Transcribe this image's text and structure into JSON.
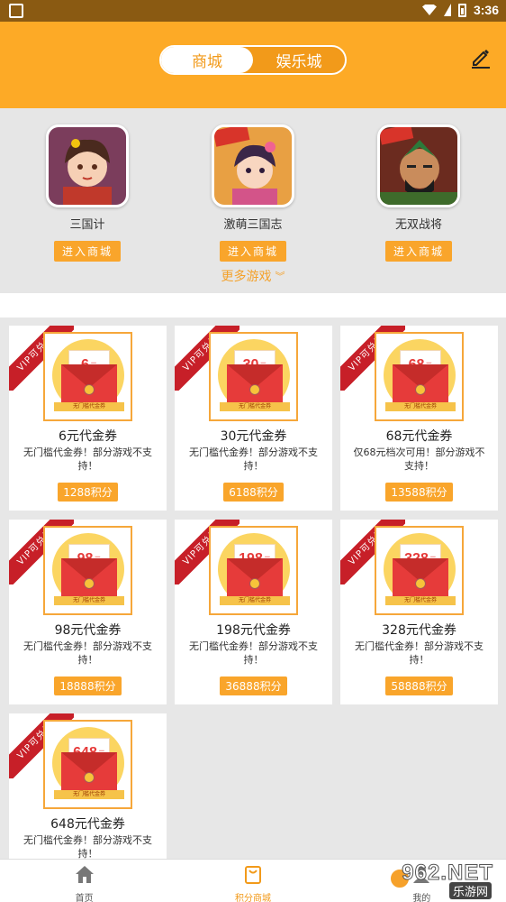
{
  "status_bar": {
    "time": "3:36"
  },
  "header": {
    "tabs": [
      {
        "label": "商城",
        "active": true
      },
      {
        "label": "娱乐城",
        "active": false
      }
    ],
    "edit_icon": "pencil-icon"
  },
  "games": [
    {
      "name": "三国计",
      "button": "进入商城",
      "art": "heroine"
    },
    {
      "name": "激萌三国志",
      "button": "进入商城",
      "art": "heroine2"
    },
    {
      "name": "无双战将",
      "button": "进入商城",
      "art": "warrior"
    }
  ],
  "more_games": "更多游戏",
  "badge_text": "VIP可兑换",
  "coupon_strip": "无门槛代金券",
  "coupons": [
    {
      "amount": "6",
      "unit": "元",
      "title": "6元代金券",
      "desc": "无门槛代金券！部分游戏不支持！",
      "points": "1288积分"
    },
    {
      "amount": "30",
      "unit": "元",
      "title": "30元代金券",
      "desc": "无门槛代金券！部分游戏不支持！",
      "points": "6188积分"
    },
    {
      "amount": "68",
      "unit": "元",
      "title": "68元代金券",
      "desc": "仅68元档次可用！部分游戏不支持！",
      "points": "13588积分"
    },
    {
      "amount": "98",
      "unit": "元",
      "title": "98元代金券",
      "desc": "无门槛代金券！部分游戏不支持！",
      "points": "18888积分"
    },
    {
      "amount": "198",
      "unit": "元",
      "title": "198元代金券",
      "desc": "无门槛代金券！部分游戏不支持！",
      "points": "36888积分"
    },
    {
      "amount": "328",
      "unit": "元",
      "title": "328元代金券",
      "desc": "无门槛代金券！部分游戏不支持！",
      "points": "58888积分"
    },
    {
      "amount": "648",
      "unit": "元",
      "title": "648元代金券",
      "desc": "无门槛代金券！部分游戏不支持！",
      "points": ""
    }
  ],
  "tabbar": [
    {
      "label": "首页",
      "icon": "home-icon",
      "active": false
    },
    {
      "label": "积分商城",
      "icon": "shop-bag-icon",
      "active": true
    },
    {
      "label": "我的",
      "icon": "user-icon",
      "active": false
    }
  ],
  "watermark": {
    "main": "962.NET",
    "sub": "乐游网"
  },
  "colors": {
    "header": "#fdaa26",
    "accent": "#f9a52b",
    "ribbon": "#c71f28"
  }
}
